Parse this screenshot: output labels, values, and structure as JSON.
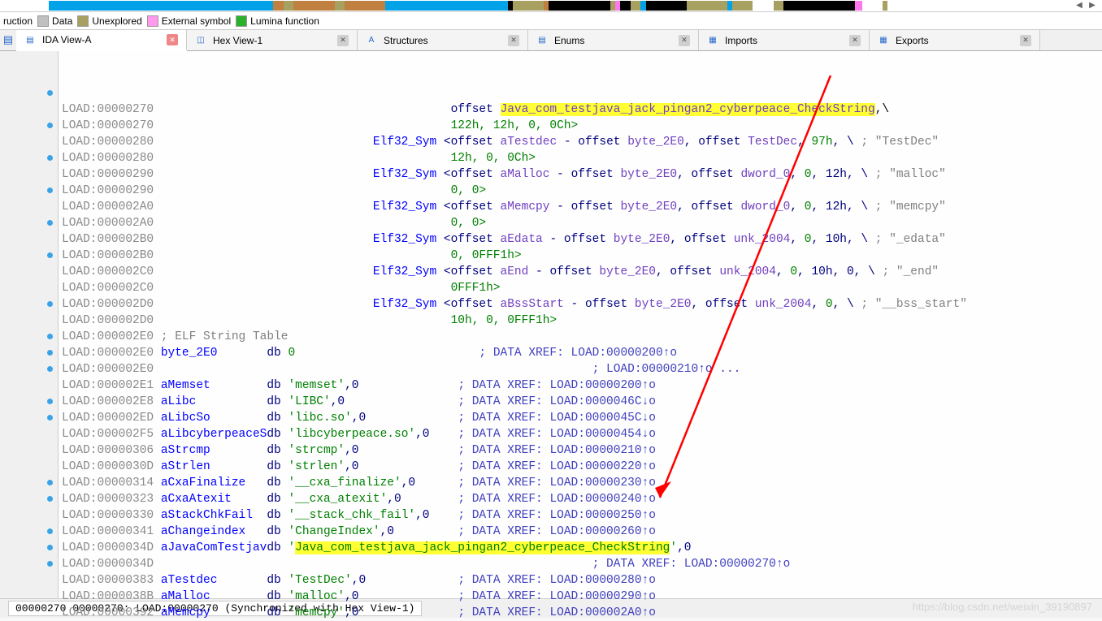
{
  "legend": {
    "instruction": "ruction",
    "data": "Data",
    "unexplored": "Unexplored",
    "external": "External symbol",
    "lumina": "Lumina function"
  },
  "tabs": [
    {
      "label": "IDA View-A",
      "active": true
    },
    {
      "label": "Hex View-1",
      "active": false
    },
    {
      "label": "Structures",
      "active": false
    },
    {
      "label": "Enums",
      "active": false
    },
    {
      "label": "Imports",
      "active": false
    },
    {
      "label": "Exports",
      "active": false
    }
  ],
  "lines": [
    {
      "addr": "LOAD:00000270",
      "dot": false,
      "kind": "off",
      "body": {
        "pre": "                                          offset ",
        "hl": "Java_com_testjava_jack_pingan2_cyberpeace_",
        "hl2": "CheckString",
        "post": ",\\"
      }
    },
    {
      "addr": "LOAD:00000270",
      "dot": false,
      "kind": "vals",
      "body": {
        "txt": "                                          122h, 12h, 0, 0Ch>"
      }
    },
    {
      "addr": "LOAD:00000280",
      "dot": true,
      "kind": "sym",
      "body": {
        "name": "Elf32_Sym",
        "args": "<offset aTestdec - offset byte_2E0, offset TestDec, ",
        "green": "97h",
        "post": ", \\",
        "cmt": "; \"TestDec\""
      }
    },
    {
      "addr": "LOAD:00000280",
      "dot": false,
      "kind": "vals",
      "body": {
        "txt": "                                          12h, 0, 0Ch>"
      }
    },
    {
      "addr": "LOAD:00000290",
      "dot": true,
      "kind": "sym",
      "body": {
        "name": "Elf32_Sym",
        "args": "<offset aMalloc - offset byte_2E0, offset dword_0, ",
        "green": "0",
        "post": ", 12h, \\",
        "cmt": "; \"malloc\""
      }
    },
    {
      "addr": "LOAD:00000290",
      "dot": false,
      "kind": "vals",
      "body": {
        "txt": "                                          0, 0>"
      }
    },
    {
      "addr": "LOAD:000002A0",
      "dot": true,
      "kind": "sym",
      "body": {
        "name": "Elf32_Sym",
        "args": "<offset aMemcpy - offset byte_2E0, offset dword_0, ",
        "green": "0",
        "post": ", 12h, \\",
        "cmt": "; \"memcpy\""
      }
    },
    {
      "addr": "LOAD:000002A0",
      "dot": false,
      "kind": "vals",
      "body": {
        "txt": "                                          0, 0>"
      }
    },
    {
      "addr": "LOAD:000002B0",
      "dot": true,
      "kind": "sym",
      "body": {
        "name": "Elf32_Sym",
        "args": "<offset aEdata - offset byte_2E0, offset unk_2004, ",
        "green": "0",
        "post": ", 10h, \\",
        "cmt": "; \"_edata\""
      }
    },
    {
      "addr": "LOAD:000002B0",
      "dot": false,
      "kind": "vals",
      "body": {
        "txt": "                                          0, 0FFF1h>"
      }
    },
    {
      "addr": "LOAD:000002C0",
      "dot": true,
      "kind": "sym2",
      "body": {
        "name": "Elf32_Sym",
        "args": "<offset aEnd - offset byte_2E0, offset unk_2004, ",
        "green": "0",
        "post": ", 10h, 0, \\",
        "cmt": "; \"_end\""
      }
    },
    {
      "addr": "LOAD:000002C0",
      "dot": false,
      "kind": "vals",
      "body": {
        "txt": "                                          0FFF1h>"
      }
    },
    {
      "addr": "LOAD:000002D0",
      "dot": true,
      "kind": "sym",
      "body": {
        "name": "Elf32_Sym",
        "args": "<offset aBssStart - offset byte_2E0, offset unk_2004, ",
        "green": "0",
        "post": ", \\",
        "cmt": "; \"__bss_start\""
      }
    },
    {
      "addr": "LOAD:000002D0",
      "dot": false,
      "kind": "vals",
      "body": {
        "txt": "                                          10h, 0, 0FFF1h>"
      }
    },
    {
      "addr": "LOAD:000002E0",
      "dot": false,
      "kind": "cmt",
      "body": {
        "txt": "; ELF String Table"
      }
    },
    {
      "addr": "LOAD:000002E0",
      "dot": true,
      "kind": "db0",
      "body": {
        "label": "byte_2E0",
        "db": "db ",
        "val": "0",
        "xref": "; DATA XREF: LOAD:00000200↑o"
      }
    },
    {
      "addr": "LOAD:000002E0",
      "dot": false,
      "kind": "xref2",
      "body": {
        "xref": "; LOAD:00000210↑o ..."
      }
    },
    {
      "addr": "LOAD:000002E1",
      "dot": true,
      "kind": "dbstr",
      "body": {
        "label": "aMemset",
        "str": "'memset'",
        "zero": ",0",
        "xref": "; DATA XREF: LOAD:00000200↑o"
      }
    },
    {
      "addr": "LOAD:000002E8",
      "dot": true,
      "kind": "dbstr",
      "body": {
        "label": "aLibc",
        "str": "'LIBC'",
        "zero": ",0",
        "xref": "; DATA XREF: LOAD:0000046C↓o"
      }
    },
    {
      "addr": "LOAD:000002ED",
      "dot": true,
      "kind": "dbstr",
      "body": {
        "label": "aLibcSo",
        "str": "'libc.so'",
        "zero": ",0",
        "xref": "; DATA XREF: LOAD:0000045C↓o"
      }
    },
    {
      "addr": "LOAD:000002F5",
      "dot": false,
      "kind": "dbstr",
      "body": {
        "label": "aLibcyberpeaceS",
        "str": "'libcyberpeace.so'",
        "zero": ",0",
        "xref": "; DATA XREF: LOAD:00000454↓o"
      }
    },
    {
      "addr": "LOAD:00000306",
      "dot": true,
      "kind": "dbstr",
      "body": {
        "label": "aStrcmp",
        "str": "'strcmp'",
        "zero": ",0",
        "xref": "; DATA XREF: LOAD:00000210↑o"
      }
    },
    {
      "addr": "LOAD:0000030D",
      "dot": true,
      "kind": "dbstr",
      "body": {
        "label": "aStrlen",
        "str": "'strlen'",
        "zero": ",0",
        "xref": "; DATA XREF: LOAD:00000220↑o"
      }
    },
    {
      "addr": "LOAD:00000314",
      "dot": false,
      "kind": "dbstr",
      "body": {
        "label": "aCxaFinalize",
        "str": "'__cxa_finalize'",
        "zero": ",0",
        "xref": "; DATA XREF: LOAD:00000230↑o"
      }
    },
    {
      "addr": "LOAD:00000323",
      "dot": false,
      "kind": "dbstr",
      "body": {
        "label": "aCxaAtexit",
        "str": "'__cxa_atexit'",
        "zero": ",0",
        "xref": "; DATA XREF: LOAD:00000240↑o"
      }
    },
    {
      "addr": "LOAD:00000330",
      "dot": false,
      "kind": "dbstr",
      "body": {
        "label": "aStackChkFail",
        "str": "'__stack_chk_fail'",
        "zero": ",0",
        "xref": "; DATA XREF: LOAD:00000250↑o"
      }
    },
    {
      "addr": "LOAD:00000341",
      "dot": true,
      "kind": "dbstr",
      "body": {
        "label": "aChangeindex",
        "str": "'ChangeIndex'",
        "zero": ",0",
        "xref": "; DATA XREF: LOAD:00000260↑o"
      }
    },
    {
      "addr": "LOAD:0000034D",
      "dot": true,
      "kind": "dbhl",
      "body": {
        "label": "aJavaComTestjav",
        "pre": "'",
        "hl": "Java_com_testjava_jack_pingan2_cyberpeace_CheckString",
        "post": "',0"
      }
    },
    {
      "addr": "LOAD:0000034D",
      "dot": false,
      "kind": "xref2",
      "body": {
        "xref": "; DATA XREF: LOAD:00000270↑o"
      }
    },
    {
      "addr": "LOAD:00000383",
      "dot": true,
      "kind": "dbstr",
      "body": {
        "label": "aTestdec",
        "str": "'TestDec'",
        "zero": ",0",
        "xref": "; DATA XREF: LOAD:00000280↑o"
      }
    },
    {
      "addr": "LOAD:0000038B",
      "dot": true,
      "kind": "dbstr",
      "body": {
        "label": "aMalloc",
        "str": "'malloc'",
        "zero": ",0",
        "xref": "; DATA XREF: LOAD:00000290↑o"
      }
    },
    {
      "addr": "LOAD:00000392",
      "dot": true,
      "kind": "dbstr",
      "body": {
        "label": "aMemcpy",
        "str": "'memcpy'",
        "zero": ",0",
        "xref": "; DATA XREF: LOAD:000002A0↑o"
      }
    }
  ],
  "status": "00000270 00000270: LOAD:00000270 (Synchronized with Hex View-1)",
  "watermark": "https://blog.csdn.net/weixin_39190897"
}
